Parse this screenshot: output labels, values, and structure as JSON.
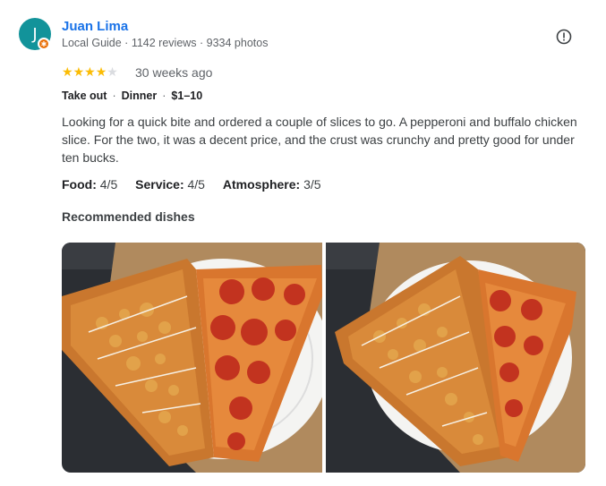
{
  "reviewer": {
    "initial": "J",
    "name": "Juan Lima",
    "meta": "Local Guide · 1142 reviews · 9334 photos",
    "avatar_color": "#12939a"
  },
  "review": {
    "rating": 4,
    "rating_max": 5,
    "time_ago": "30 weeks ago",
    "tags": [
      "Take out",
      "Dinner",
      "$1–10"
    ],
    "text": "Looking for a quick bite and ordered a couple of slices to go. A pepperoni and buffalo chicken slice. For the two, it was a decent price, and the crust was crunchy and pretty good for under ten bucks.",
    "ratings": [
      {
        "label": "Food:",
        "value": "4/5"
      },
      {
        "label": "Service:",
        "value": "4/5"
      },
      {
        "label": "Atmosphere:",
        "value": "3/5"
      }
    ],
    "recommended_label": "Recommended dishes"
  },
  "icons": {
    "report": "report-flag-icon",
    "star": "star-icon",
    "badge": "local-guide-badge-icon"
  },
  "colors": {
    "name": "#1a73e8",
    "star_on": "#fbbc04",
    "star_off": "#dadce0"
  }
}
